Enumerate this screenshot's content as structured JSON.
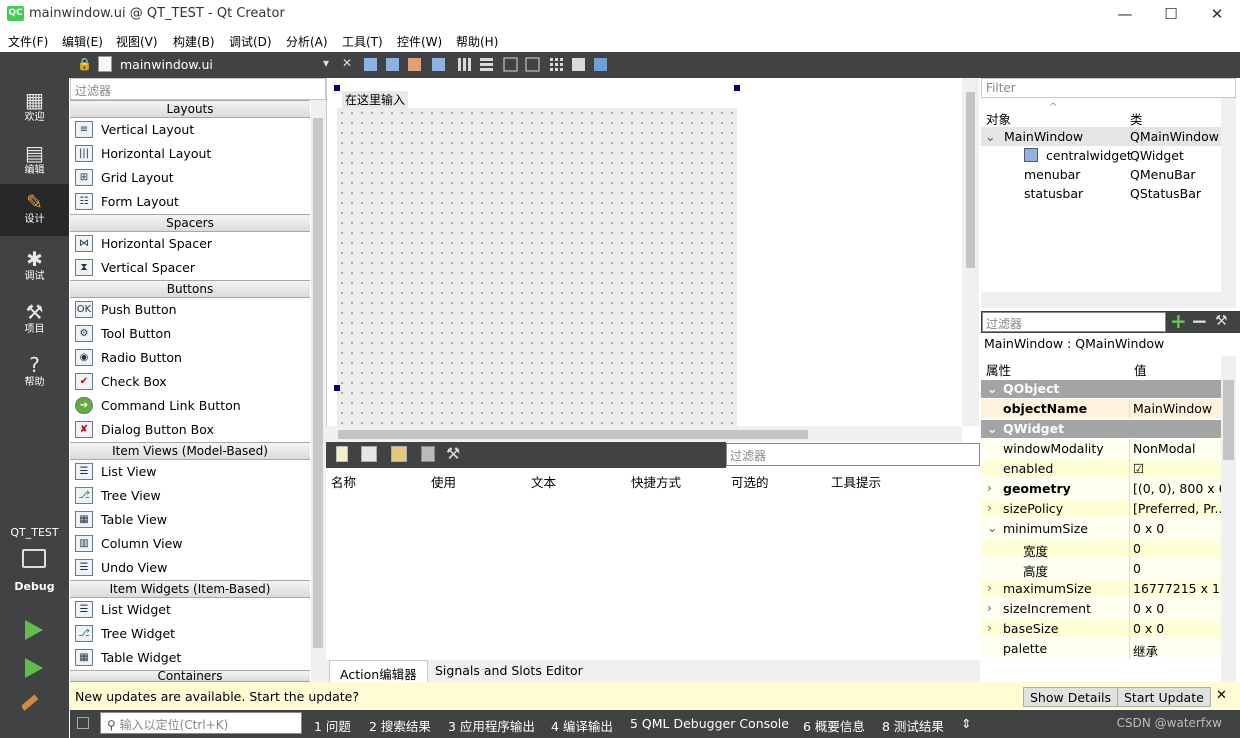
{
  "window": {
    "logo": "QC",
    "title": "mainwindow.ui @ QT_TEST - Qt Creator",
    "min": "—",
    "max": "☐",
    "close": "✕"
  },
  "menus": [
    "文件(F)",
    "编辑(E)",
    "视图(V)",
    "构建(B)",
    "调试(D)",
    "分析(A)",
    "工具(T)",
    "控件(W)",
    "帮助(H)"
  ],
  "editor_toolbar": {
    "file": "mainwindow.ui",
    "dropdown": "▾",
    "close": "✕"
  },
  "modes": [
    {
      "label": "欢迎",
      "icon": "grid-icon"
    },
    {
      "label": "编辑",
      "icon": "edit-doc-icon"
    },
    {
      "label": "设计",
      "icon": "pencil-icon"
    },
    {
      "label": "调试",
      "icon": "bug-icon"
    },
    {
      "label": "项目",
      "icon": "wrench-icon"
    },
    {
      "label": "帮助",
      "icon": "help-icon"
    }
  ],
  "kit": {
    "project": "QT_TEST",
    "config": "Debug"
  },
  "widgetbox": {
    "filter_placeholder": "过滤器",
    "categories": [
      {
        "name": "Layouts",
        "items": [
          "Vertical Layout",
          "Horizontal Layout",
          "Grid Layout",
          "Form Layout"
        ]
      },
      {
        "name": "Spacers",
        "items": [
          "Horizontal Spacer",
          "Vertical Spacer"
        ]
      },
      {
        "name": "Buttons",
        "items": [
          "Push Button",
          "Tool Button",
          "Radio Button",
          "Check Box",
          "Command Link Button",
          "Dialog Button Box"
        ]
      },
      {
        "name": "Item Views (Model-Based)",
        "items": [
          "List View",
          "Tree View",
          "Table View",
          "Column View",
          "Undo View"
        ]
      },
      {
        "name": "Item Widgets (Item-Based)",
        "items": [
          "List Widget",
          "Tree Widget",
          "Table Widget"
        ]
      },
      {
        "name": "Containers",
        "items": []
      }
    ]
  },
  "form": {
    "type_here": "在这里输入"
  },
  "action_editor": {
    "filter_placeholder": "过滤器",
    "columns": [
      "名称",
      "使用",
      "文本",
      "快捷方式",
      "可选的",
      "工具提示"
    ],
    "tabs": [
      "Action编辑器",
      "Signals and Slots Editor"
    ]
  },
  "object_inspector": {
    "filter_placeholder": "Filter",
    "columns": [
      "对象",
      "类"
    ],
    "rows": [
      {
        "object": "MainWindow",
        "class": "QMainWindow"
      },
      {
        "object": "centralwidget",
        "class": "QWidget"
      },
      {
        "object": "menubar",
        "class": "QMenuBar"
      },
      {
        "object": "statusbar",
        "class": "QStatusBar"
      }
    ]
  },
  "property_editor": {
    "filter_placeholder": "过滤器",
    "class_label": "MainWindow : QMainWindow",
    "columns": [
      "属性",
      "值"
    ],
    "cat_qobject": "QObject",
    "cat_qwidget": "QWidget",
    "props": [
      {
        "name": "objectName",
        "value": "MainWindow"
      },
      {
        "name": "windowModality",
        "value": "NonModal"
      },
      {
        "name": "enabled",
        "value": "☑"
      },
      {
        "name": "geometry",
        "value": "[(0, 0), 800 x 6..."
      },
      {
        "name": "sizePolicy",
        "value": "[Preferred, Pr..."
      },
      {
        "name": "minimumSize",
        "value": "0 x 0"
      },
      {
        "name": "宽度",
        "value": "0"
      },
      {
        "name": "高度",
        "value": "0"
      },
      {
        "name": "maximumSize",
        "value": "16777215 x 1..."
      },
      {
        "name": "sizeIncrement",
        "value": "0 x 0"
      },
      {
        "name": "baseSize",
        "value": "0 x 0"
      },
      {
        "name": "palette",
        "value": "继承"
      }
    ]
  },
  "infobar": {
    "message": "New updates are available. Start the update?",
    "show_details": "Show Details",
    "start_update": "Start Update",
    "close": "✕"
  },
  "statusbar": {
    "locate_placeholder": "输入以定位(Ctrl+K)",
    "panes": [
      "1  问题",
      "2  搜索结果",
      "3  应用程序输出",
      "4  编译输出",
      "5  QML Debugger Console",
      "6  概要信息",
      "8  测试结果"
    ],
    "more": "⇕",
    "watermark": "CSDN @waterfxw"
  },
  "colors": {
    "dark": "#404244",
    "accent": "#41cd52",
    "prop_row": "#ffffd6",
    "category": "#a4a4a4"
  }
}
